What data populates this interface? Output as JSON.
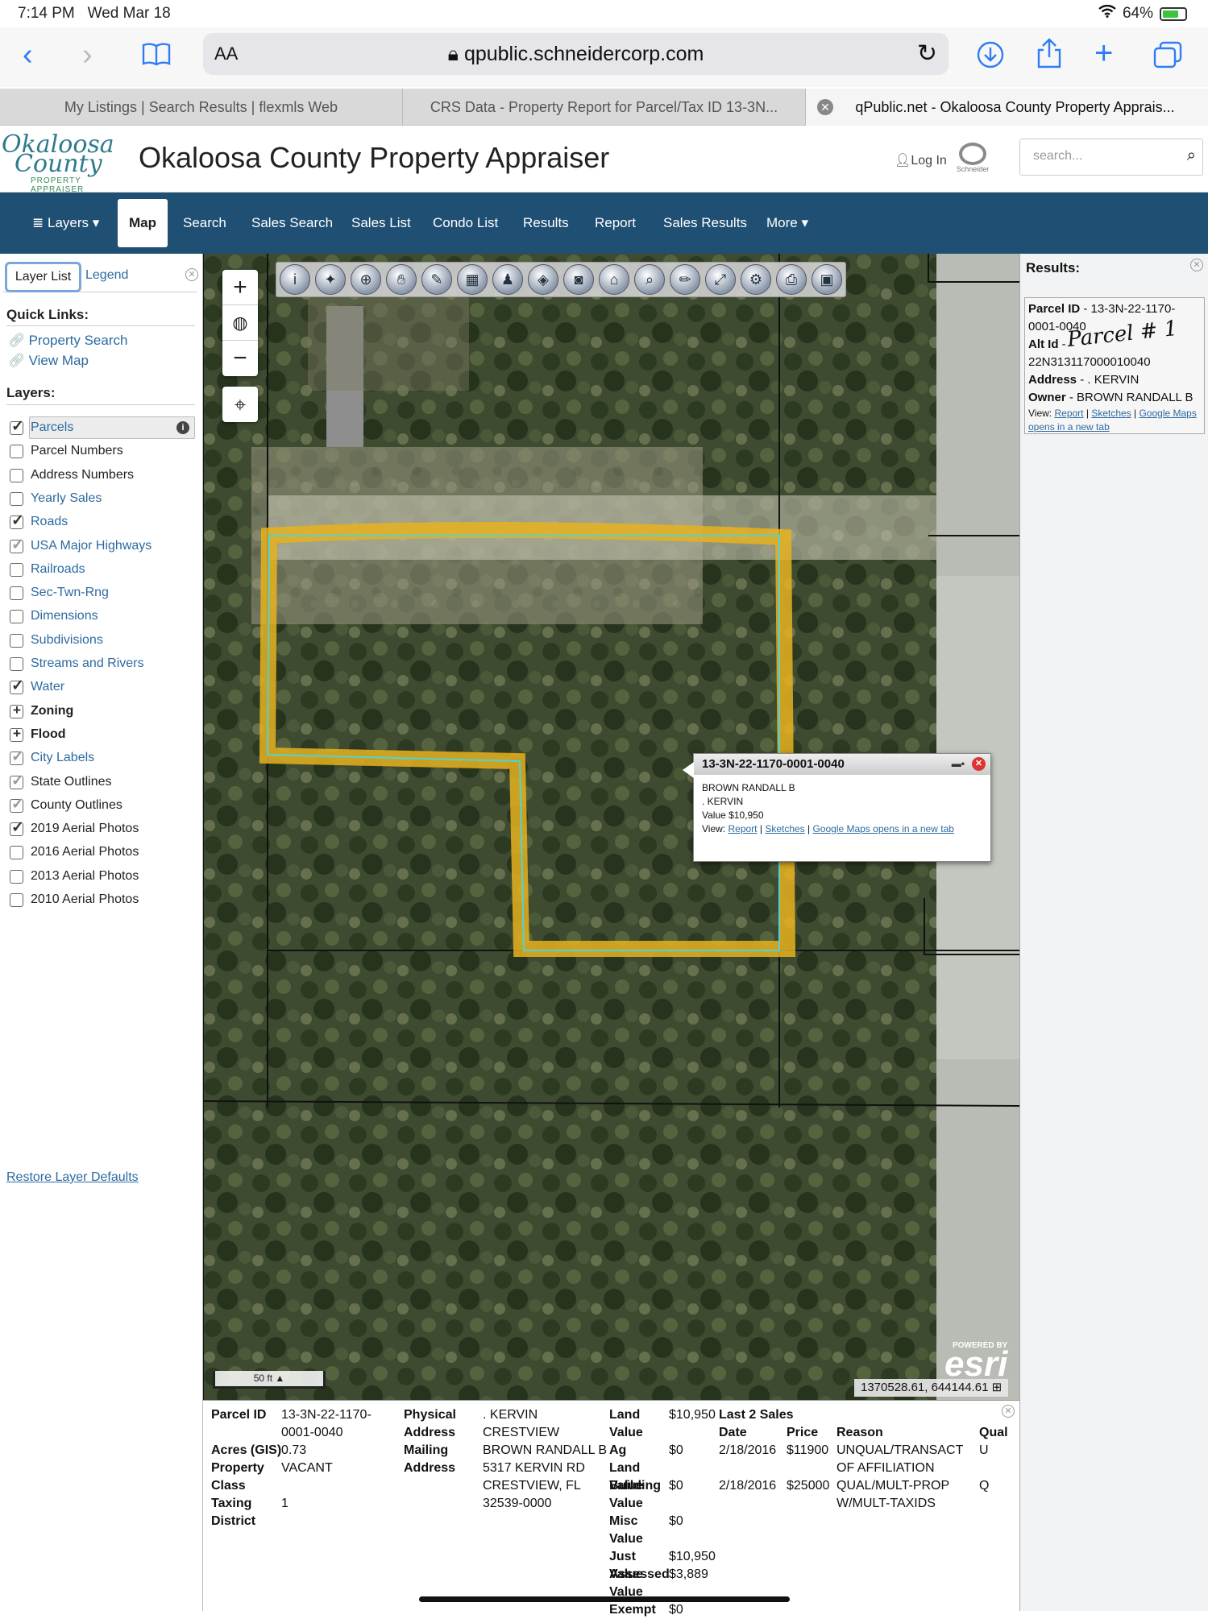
{
  "status": {
    "time": "7:14 PM",
    "date": "Wed Mar 18",
    "battery": "64%"
  },
  "browser": {
    "aa": "AA",
    "url": "qpublic.schneidercorp.com",
    "tabs": [
      {
        "label": "My Listings | Search Results | flexmls Web",
        "active": false
      },
      {
        "label": "CRS Data - Property Report for Parcel/Tax ID 13-3N...",
        "active": false
      },
      {
        "label": "qPublic.net - Okaloosa County Property Apprais...",
        "active": true
      }
    ]
  },
  "header": {
    "logo_line1": "Okaloosa",
    "logo_line2": "County",
    "logo_line3": "PROPERTY APPRAISER",
    "title": "Okaloosa County Property Appraiser",
    "login": "Log In",
    "schneider": "Schneider",
    "search_placeholder": "search..."
  },
  "nav": {
    "items": [
      {
        "label": "Layers",
        "active": false
      },
      {
        "label": "Map",
        "active": true
      },
      {
        "label": "Search",
        "active": false
      },
      {
        "label": "Sales Search",
        "active": false
      },
      {
        "label": "Sales List",
        "active": false
      },
      {
        "label": "Condo List",
        "active": false
      },
      {
        "label": "Results",
        "active": false
      },
      {
        "label": "Report",
        "active": false
      },
      {
        "label": "Sales Results",
        "active": false
      },
      {
        "label": "More",
        "active": false
      }
    ]
  },
  "left": {
    "tab_layer_list": "Layer List",
    "tab_legend": "Legend",
    "quick_links_heading": "Quick Links:",
    "quick_links": [
      "Property Search",
      "View Map"
    ],
    "layers_heading": "Layers:",
    "layers": [
      {
        "label": "Parcels",
        "checked": true,
        "style": "link"
      },
      {
        "label": "Parcel Numbers",
        "checked": false,
        "style": "dark"
      },
      {
        "label": "Address Numbers",
        "checked": false,
        "style": "dark"
      },
      {
        "label": "Yearly Sales",
        "checked": false,
        "style": "link"
      },
      {
        "label": "Roads",
        "checked": true,
        "style": "link"
      },
      {
        "label": "USA Major Highways",
        "checked": true,
        "dim": true,
        "style": "link"
      },
      {
        "label": "Railroads",
        "checked": false,
        "style": "link"
      },
      {
        "label": "Sec-Twn-Rng",
        "checked": false,
        "style": "link"
      },
      {
        "label": "Dimensions",
        "checked": false,
        "style": "link"
      },
      {
        "label": "Subdivisions",
        "checked": false,
        "style": "link"
      },
      {
        "label": "Streams and Rivers",
        "checked": false,
        "style": "link"
      },
      {
        "label": "Water",
        "checked": true,
        "style": "link"
      },
      {
        "label": "Zoning",
        "group": true,
        "style": "bold"
      },
      {
        "label": "Flood",
        "group": true,
        "style": "bold"
      },
      {
        "label": "City Labels",
        "checked": true,
        "dim": true,
        "style": "link"
      },
      {
        "label": "State Outlines",
        "checked": true,
        "dim": true,
        "style": "dark"
      },
      {
        "label": "County Outlines",
        "checked": true,
        "dim": true,
        "style": "dark"
      },
      {
        "label": "2019 Aerial Photos",
        "checked": true,
        "style": "dark"
      },
      {
        "label": "2016 Aerial Photos",
        "checked": false,
        "style": "dark"
      },
      {
        "label": "2013 Aerial Photos",
        "checked": false,
        "style": "dark"
      },
      {
        "label": "2010 Aerial Photos",
        "checked": false,
        "style": "dark"
      }
    ],
    "restore": "Restore Layer Defaults"
  },
  "map": {
    "popup": {
      "title": "13-3N-22-1170-0001-0040",
      "owner": "BROWN RANDALL B",
      "address": ". KERVIN",
      "value": "Value $10,950",
      "view_label": "View:",
      "links": [
        "Report",
        "Sketches",
        "Google Maps opens in a new tab"
      ]
    },
    "scale": "50 ft",
    "esri_powered": "POWERED BY",
    "esri_logo": "esri",
    "coords": "1370528.61, 644144.61"
  },
  "results": {
    "heading": "Results:",
    "parcel_id_label": "Parcel ID",
    "parcel_id": " - 13-3N-22-1170-0001-0040",
    "alt_id_label": "Alt Id",
    "alt_id": " - ",
    "alt_id_value": "22N313117000010040",
    "address_label": "Address",
    "address": " - . KERVIN",
    "owner_label": "Owner",
    "owner": " - BROWN RANDALL B",
    "view_label": "View:",
    "links": [
      "Report",
      "Sketches",
      "Google Maps opens in a new tab"
    ],
    "handwriting": "Parcel # 1"
  },
  "detail": {
    "parcel_id_label": "Parcel ID",
    "parcel_id": "13-3N-22-1170-0001-0040",
    "acres_label": "Acres (GIS)",
    "acres": "0.73",
    "property_class_label": "Property Class",
    "property_class": "VACANT",
    "taxing_label": "Taxing District",
    "taxing": "1",
    "physical_label": "Physical Address",
    "physical": ". KERVIN CRESTVIEW",
    "mailing_label": "Mailing Address",
    "mailing_l1": "BROWN RANDALL B",
    "mailing_l2": "5317 KERVIN RD",
    "mailing_l3": "CRESTVIEW, FL",
    "mailing_l4": "32539-0000",
    "values": [
      {
        "label": "Land Value",
        "value": "$10,950"
      },
      {
        "label": "Ag Land Value",
        "value": "$0"
      },
      {
        "label": "Building Value",
        "value": "$0"
      },
      {
        "label": "Misc Value",
        "value": "$0"
      },
      {
        "label": "Just Value",
        "value": "$10,950"
      },
      {
        "label": "Assessed Value",
        "value": "$3,889"
      },
      {
        "label": "Exempt",
        "value": "$0"
      }
    ],
    "sales_heading": "Last 2 Sales",
    "sales_columns": [
      "Date",
      "Price",
      "Reason",
      "Qual"
    ],
    "sales": [
      {
        "date": "2/18/2016",
        "price": "$11900",
        "reason": "UNQUAL/TRANSACT OF AFFILIATION",
        "qual": "U"
      },
      {
        "date": "2/18/2016",
        "price": "$25000",
        "reason": "QUAL/MULT-PROP W/MULT-TAXIDS",
        "qual": "Q"
      }
    ]
  },
  "colors": {
    "nav_bg": "#1f4f73",
    "link": "#2d6aa0",
    "parcel_highlight": "#e8b21f",
    "parcel_outline": "#4fd3d8"
  }
}
